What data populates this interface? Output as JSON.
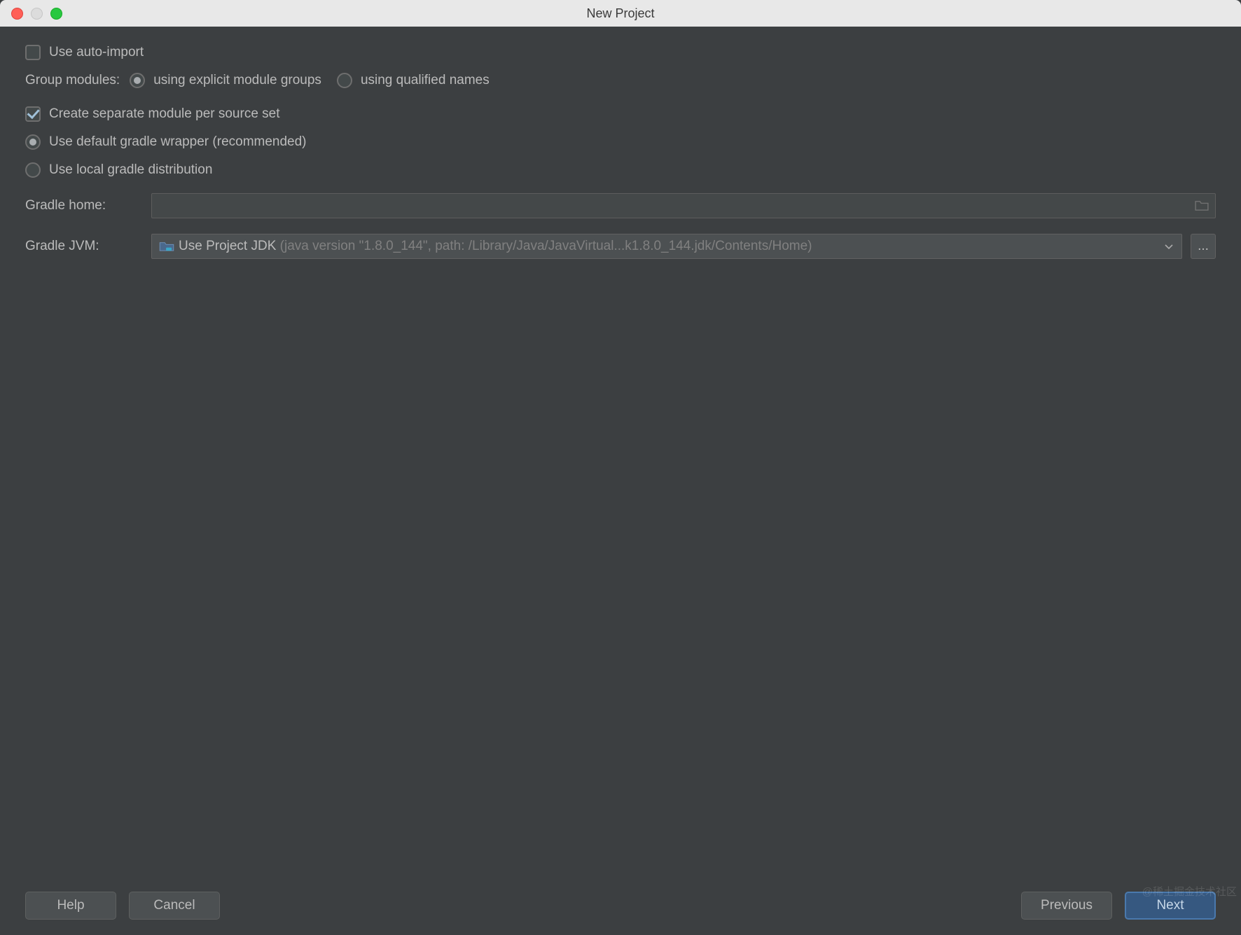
{
  "window": {
    "title": "New Project"
  },
  "options": {
    "auto_import": {
      "label": "Use auto-import",
      "checked": false
    },
    "group_modules_label": "Group modules:",
    "group_modules": {
      "explicit": {
        "label": "using explicit module groups",
        "checked": true
      },
      "qualified": {
        "label": "using qualified names",
        "checked": false
      }
    },
    "separate_module": {
      "label": "Create separate module per source set",
      "checked": true
    },
    "wrapper_default": {
      "label": "Use default gradle wrapper (recommended)",
      "checked": true
    },
    "wrapper_local": {
      "label": "Use local gradle distribution",
      "checked": false
    }
  },
  "fields": {
    "gradle_home_label": "Gradle home:",
    "gradle_home_value": "",
    "gradle_jvm_label": "Gradle JVM:",
    "gradle_jvm_primary": "Use Project JDK",
    "gradle_jvm_detail": "(java version \"1.8.0_144\", path: /Library/Java/JavaVirtual...k1.8.0_144.jdk/Contents/Home)"
  },
  "buttons": {
    "help": "Help",
    "cancel": "Cancel",
    "previous": "Previous",
    "next": "Next",
    "more": "..."
  },
  "watermark": "@稀土掘金技术社区"
}
